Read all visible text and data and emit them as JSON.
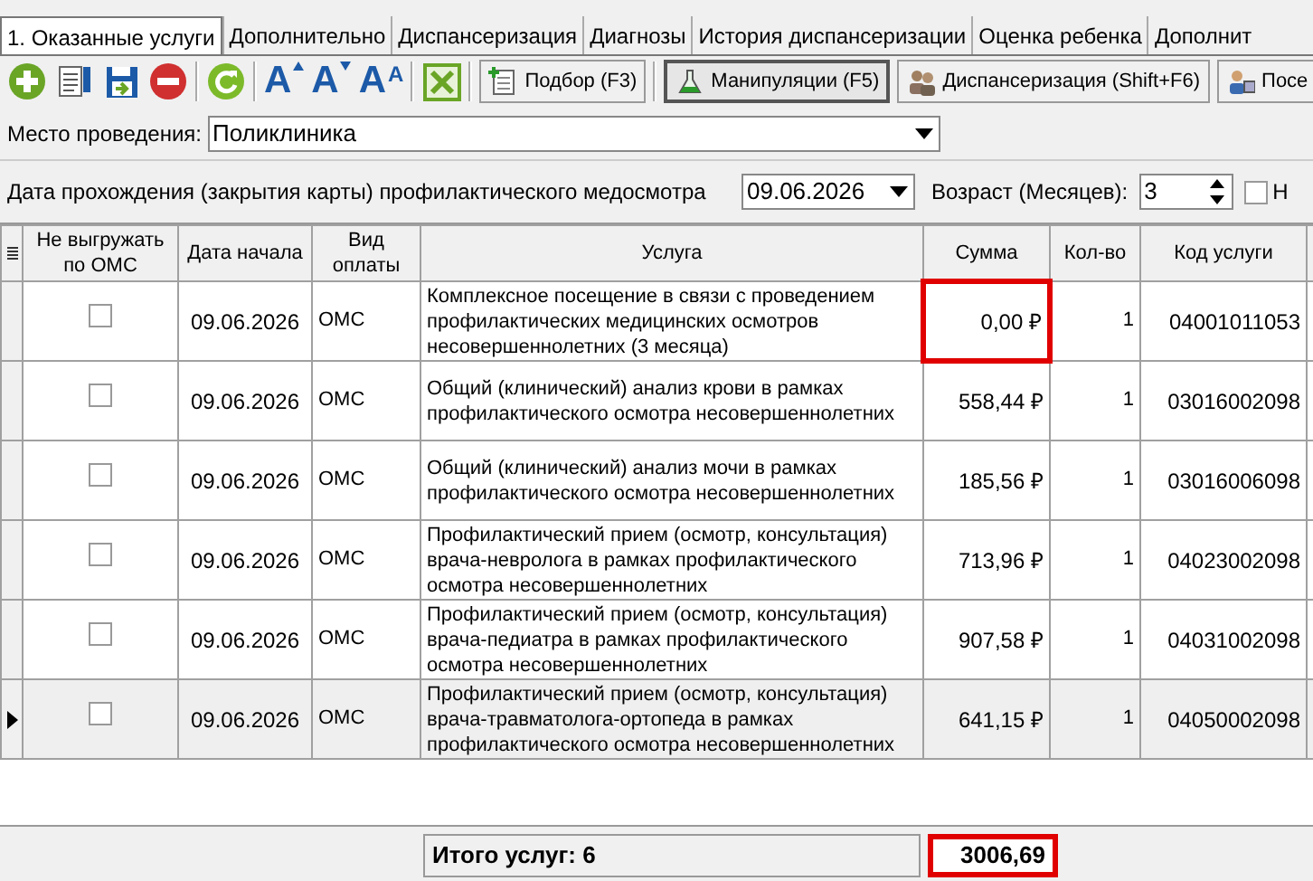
{
  "tabs": [
    {
      "label": "1. Оказанные услуги",
      "selected": true
    },
    {
      "label": "Дополнительно",
      "selected": false
    },
    {
      "label": "Диспансеризация",
      "selected": false
    },
    {
      "label": "Диагнозы",
      "selected": false
    },
    {
      "label": "История диспансеризации",
      "selected": false
    },
    {
      "label": "Оценка ребенка",
      "selected": false
    },
    {
      "label": "Дополнит",
      "selected": false
    }
  ],
  "toolbar": [
    {
      "kind": "add"
    },
    {
      "kind": "edit"
    },
    {
      "kind": "save"
    },
    {
      "kind": "delete"
    },
    {
      "kind": "sep"
    },
    {
      "kind": "refresh"
    },
    {
      "kind": "sep"
    },
    {
      "kind": "font_larger",
      "label": "A"
    },
    {
      "kind": "font_smaller",
      "label": "A"
    },
    {
      "kind": "font_default",
      "label": "A",
      "sup": "A"
    },
    {
      "kind": "sep"
    },
    {
      "kind": "excel"
    },
    {
      "kind": "sep"
    },
    {
      "kind": "text",
      "label": "Подбор (F3)",
      "selected": false
    },
    {
      "kind": "sep"
    },
    {
      "kind": "text",
      "label": "Манипуляции (F5)",
      "selected": true
    },
    {
      "kind": "text",
      "label": "Диспансеризация (Shift+F6)",
      "selected": false
    },
    {
      "kind": "text",
      "label": "Посе",
      "selected": false
    }
  ],
  "place": {
    "label": "Место проведения:",
    "value": "Поликлиника"
  },
  "exam": {
    "label": "Дата прохождения (закрытия карты) профилактического медосмотра",
    "date": "09.06.2026",
    "age_label": "Возраст (Месяцев):",
    "age": "3",
    "check_label": "Н",
    "checked": false
  },
  "table": {
    "columns": [
      "Не выгружать по ОМС",
      "Дата начала",
      "Вид оплаты",
      "Услуга",
      "Сумма",
      "Кол-во",
      "Код услуги"
    ],
    "rows": [
      {
        "no_export": false,
        "date": "09.06.2026",
        "payment": "ОМС",
        "service": "Комплексное посещение  в связи с проведением профилактических медицинских осмотров несовершеннолетних (3 месяца)",
        "sum": "0,00 ₽",
        "qty": "1",
        "code": "04001011053",
        "current": false,
        "highlighted": true
      },
      {
        "no_export": false,
        "date": "09.06.2026",
        "payment": "ОМС",
        "service": "Общий (клинический) анализ крови в рамках профилактического осмотра несовершеннолетних",
        "sum": "558,44 ₽",
        "qty": "1",
        "code": "03016002098",
        "current": false,
        "highlighted": false
      },
      {
        "no_export": false,
        "date": "09.06.2026",
        "payment": "ОМС",
        "service": "Общий (клинический) анализ мочи в рамках профилактического осмотра несовершеннолетних",
        "sum": "185,56 ₽",
        "qty": "1",
        "code": "03016006098",
        "current": false,
        "highlighted": false
      },
      {
        "no_export": false,
        "date": "09.06.2026",
        "payment": "ОМС",
        "service": "Профилактический прием (осмотр, консультация) врача-невролога в рамках профилактического осмотра несовершеннолетних",
        "sum": "713,96 ₽",
        "qty": "1",
        "code": "04023002098",
        "current": false,
        "highlighted": false
      },
      {
        "no_export": false,
        "date": "09.06.2026",
        "payment": "ОМС",
        "service": "Профилактический прием (осмотр, консультация) врача-педиатра в рамках профилактического осмотра несовершеннолетних",
        "sum": "907,58 ₽",
        "qty": "1",
        "code": "04031002098",
        "current": false,
        "highlighted": false
      },
      {
        "no_export": false,
        "date": "09.06.2026",
        "payment": "ОМС",
        "service": "Профилактический прием (осмотр, консультация) врача-травматолога-ортопеда в рамках профилактического осмотра несовершеннолетних",
        "sum": "641,15 ₽",
        "qty": "1",
        "code": "04050002098",
        "current": true,
        "highlighted": false
      }
    ],
    "footer": {
      "label": "Итого услуг: 6",
      "total": "3006,69",
      "highlighted": true
    }
  }
}
